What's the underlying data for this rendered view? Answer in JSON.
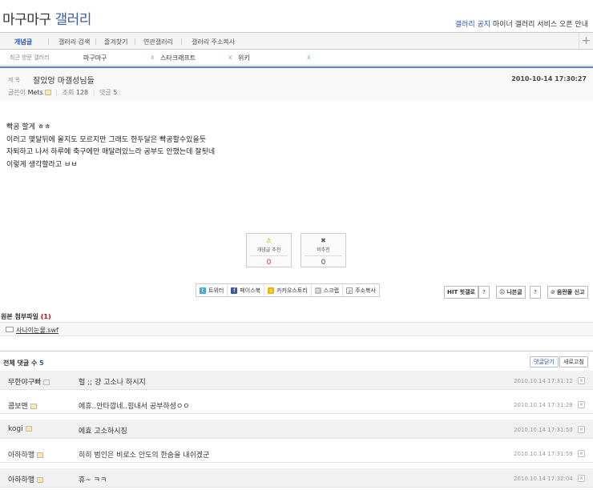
{
  "header": {
    "logo_part1": "마구마구",
    "logo_part2": "갤러리",
    "notice_tag": "갤러리 공지",
    "notice_text": "마이너 갤러리 서비스 오픈 안내"
  },
  "nav": {
    "tabs": [
      {
        "label": "개념글",
        "active": true
      },
      {
        "label": "갤러리 검색"
      },
      {
        "label": "즐겨찾기"
      },
      {
        "label": "연관갤러리"
      },
      {
        "label": "갤러리 주소복사"
      }
    ],
    "plus": "+"
  },
  "recent": {
    "label": "최근 방문 갤러리",
    "galleries": [
      "마구마구",
      "스타크래프트",
      "위키"
    ],
    "close": "x"
  },
  "post": {
    "title_label": "제 목",
    "title": "잘있엉 마갤성님들",
    "date": "2010-10-14 17:30:27",
    "author_label": "글쓴이",
    "author": "Mets",
    "views_label": "조회",
    "views": "128",
    "comments_label": "댓글",
    "comments": "5",
    "body": [
      "빡공 할게 ㅎㅎ",
      "이러고 몇달뒤에 올지도 모르지만 그래도 한두달은 빡공할수있을듯",
      "자퇴하고 나서 하루에 축구에만 매달려있느라 공부도 안했는데 잘됫네",
      "이렇게 생각할라고 ㅂㅂ"
    ]
  },
  "vote": {
    "up_label": "개념글 추천",
    "up_count": "0",
    "down_label": "비추천",
    "down_count": "0"
  },
  "share": {
    "items": [
      "트위터",
      "페이스북",
      "카카오스토리",
      "스크랩",
      "주소복사"
    ]
  },
  "actions": {
    "hit_label": "HIT 힛갤로",
    "help": "?",
    "bad_label": "나븐글",
    "report_label": "음란물 신고"
  },
  "attachment": {
    "title": "원본 첨부파일",
    "count": "(1)",
    "file": "사나이눈물.swf"
  },
  "comments": {
    "total_label": "전체 댓글 수",
    "total": "5",
    "close_button": "댓글닫기",
    "refresh_button": "새로고침",
    "delete": "×",
    "items": [
      {
        "nick": "무한야구빠",
        "msg": "헐 ;; 걍 고소나 하시지",
        "time": "2010.10.14 17:31:12"
      },
      {
        "nick": "콤보맨",
        "msg": "에휴..안타깝네..힘내서 공부하셩ㅇㅇ",
        "time": "2010.10.14 17:31:28"
      },
      {
        "nick": "kogi",
        "msg": "에효 고소하시징",
        "time": "2010.10.14 17:31:50"
      },
      {
        "nick": "아하하맹",
        "msg": "히히 범인은 비로소 안도의 한숨을 내쉬겠군",
        "time": "2010.10.14 17:31:59"
      },
      {
        "nick": "아하하맹",
        "msg": "휴~ ㅋㅋ",
        "time": "2010.10.14 17:32:04"
      }
    ]
  }
}
